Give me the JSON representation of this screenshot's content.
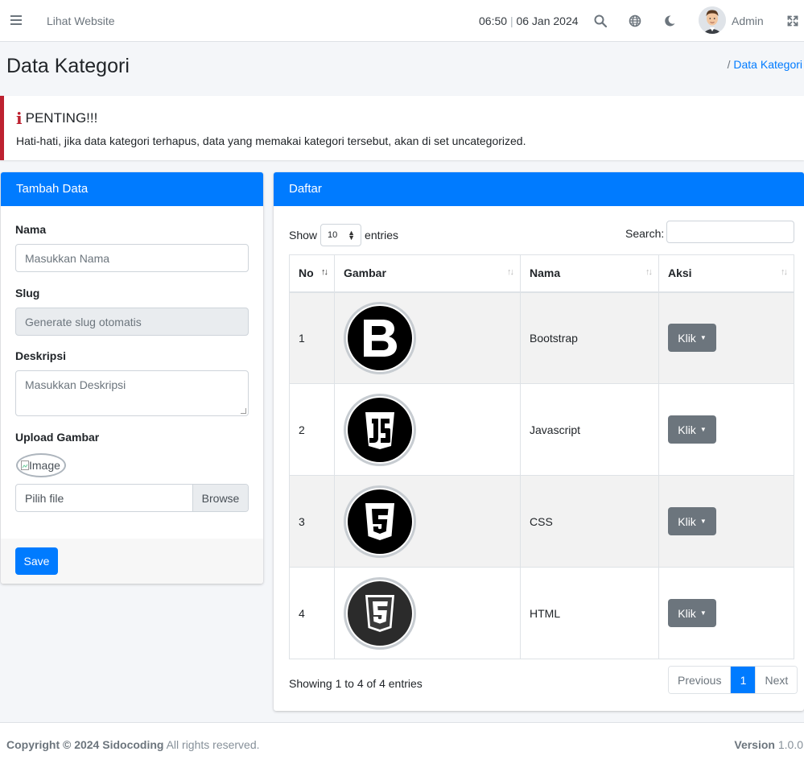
{
  "navbar": {
    "website_link": "Lihat Website",
    "time": "06:50",
    "date": "06 Jan 2024",
    "user_name": "Admin"
  },
  "header": {
    "title": "Data Kategori",
    "breadcrumb": "Data Kategori"
  },
  "callout": {
    "title": "PENTING!!!",
    "text": "Hati-hati, jika data kategori terhapus, data yang memakai kategori tersebut, akan di set uncategorized."
  },
  "form": {
    "title": "Tambah Data",
    "name_label": "Nama",
    "name_placeholder": "Masukkan Nama",
    "slug_label": "Slug",
    "slug_placeholder": "Generate slug otomatis",
    "desc_label": "Deskripsi",
    "desc_placeholder": "Masukkan Deskripsi",
    "upload_label": "Upload Gambar",
    "image_alt": "Image",
    "file_placeholder": "Pilih file",
    "browse_label": "Browse",
    "save_label": "Save"
  },
  "table": {
    "title": "Daftar",
    "show_label": "Show",
    "entries_label": "entries",
    "length_value": "10",
    "search_label": "Search:",
    "columns": [
      "No",
      "Gambar",
      "Nama",
      "Aksi"
    ],
    "rows": [
      {
        "no": "1",
        "name": "Bootstrap",
        "logo": "bootstrap-logo",
        "action": "Klik"
      },
      {
        "no": "2",
        "name": "Javascript",
        "logo": "javascript-logo",
        "action": "Klik"
      },
      {
        "no": "3",
        "name": "CSS",
        "logo": "css3-logo",
        "action": "Klik"
      },
      {
        "no": "4",
        "name": "HTML",
        "logo": "html5-logo",
        "action": "Klik"
      }
    ],
    "info": "Showing 1 to 4 of 4 entries",
    "pagination": {
      "previous": "Previous",
      "current": "1",
      "next": "Next"
    }
  },
  "footer": {
    "copyright": "Copyright © 2024 Sidocoding",
    "rights": "All rights reserved.",
    "version_label": "Version",
    "version": "1.0.0"
  },
  "colors": {
    "primary": "#007bff",
    "danger": "#bd2130",
    "secondary": "#6c757d"
  }
}
